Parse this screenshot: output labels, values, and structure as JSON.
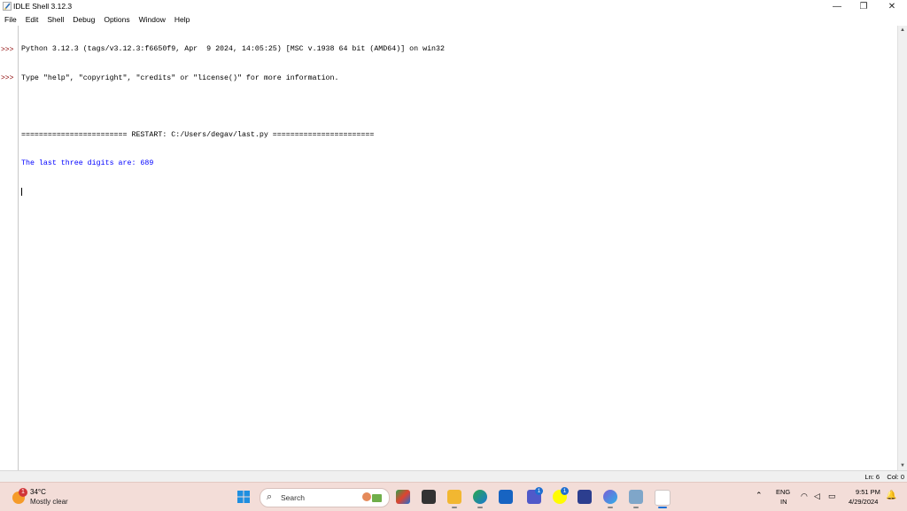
{
  "window": {
    "title": "IDLE Shell 3.12.3",
    "minimize_glyph": "—",
    "restore_glyph": "❐",
    "close_glyph": "✕"
  },
  "menu": [
    "File",
    "Edit",
    "Shell",
    "Debug",
    "Options",
    "Window",
    "Help"
  ],
  "shell": {
    "prompt": ">>>",
    "lines": [
      "Python 3.12.3 (tags/v3.12.3:f6650f9, Apr  9 2024, 14:05:25) [MSC v.1938 64 bit (AMD64)] on win32",
      "Type \"help\", \"copyright\", \"credits\" or \"license()\" for more information.",
      "",
      "======================== RESTART: C:/Users/degav/last.py =======================",
      "The last three digits are: 689",
      ""
    ]
  },
  "status": {
    "ln": "Ln: 6",
    "col": "Col: 0"
  },
  "taskbar": {
    "weather_temp": "34°C",
    "weather_condition": "Mostly clear",
    "weather_badge": "1",
    "search_label": "Search",
    "teams_badge": "1",
    "snapchat_badge": "1",
    "language": "ENG",
    "region": "IN",
    "time": "9:51 PM",
    "date": "4/29/2024"
  },
  "colors": {
    "prompt": "#8b0000",
    "output": "#0000ff",
    "taskbar_bg": "#f3ddd8"
  }
}
